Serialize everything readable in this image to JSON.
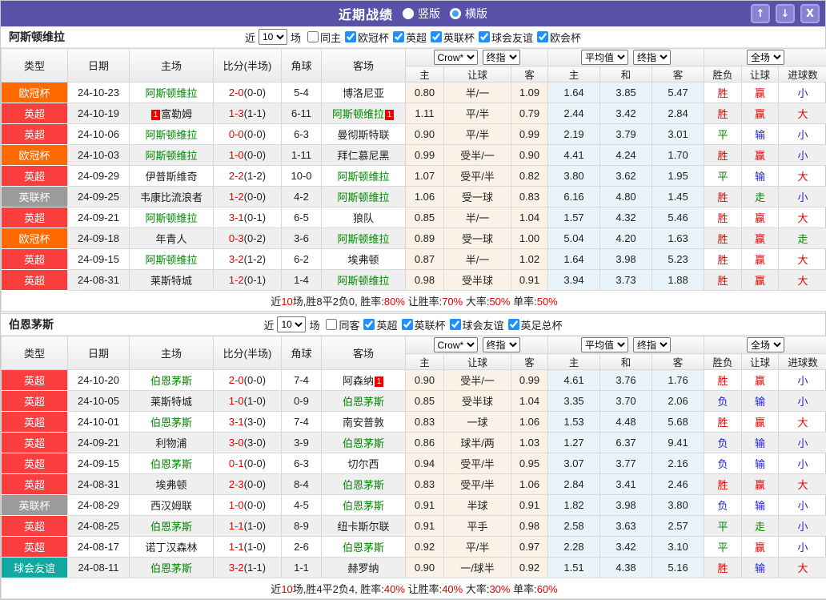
{
  "window": {
    "title": "近期战绩",
    "vertical_label": "竖版",
    "horizontal_label": "横版",
    "up_button": "↑",
    "down_button": "↓",
    "close_button": "X"
  },
  "table": {
    "cols": [
      "类型",
      "日期",
      "主场",
      "比分(半场)",
      "角球",
      "客场"
    ],
    "sub": [
      "主",
      "让球",
      "客",
      "主",
      "和",
      "客",
      "胜负",
      "让球",
      "进球数"
    ],
    "selects": {
      "crow": "Crow*",
      "final1": "终指",
      "avg": "平均值",
      "final2": "终指",
      "full": "全场"
    }
  },
  "league_colors": {
    "英超": "#fa3e3e",
    "欧冠杯": "#ff6a00",
    "英联杯": "#9b9b9b",
    "球会友谊": "#12a7a1"
  },
  "result_colors": {
    "r": "#e60000",
    "b": "#2323cc",
    "g": "#008800"
  },
  "sections": [
    {
      "team": "阿斯顿维拉",
      "filter": {
        "near": "近",
        "count": "10",
        "games": "场",
        "same": "同主",
        "same_checked": false,
        "leagues": [
          "欧冠杯",
          "英超",
          "英联杯",
          "球会友谊",
          "欧会杯"
        ]
      },
      "rows": [
        {
          "league": "欧冠杯",
          "date": "24-10-23",
          "home": "阿斯顿维拉",
          "home_self": true,
          "home_card": "",
          "score": "2-0",
          "half": "(0-0)",
          "corners": "5-4",
          "away": "博洛尼亚",
          "away_self": false,
          "away_card": "",
          "odds": [
            "0.80",
            "半/一",
            "1.09"
          ],
          "avg": [
            "1.64",
            "3.85",
            "5.47"
          ],
          "results": [
            [
              "胜",
              "r"
            ],
            [
              "赢",
              "r"
            ],
            [
              "小",
              "b"
            ]
          ]
        },
        {
          "league": "英超",
          "date": "24-10-19",
          "home": "富勒姆",
          "home_self": false,
          "home_card": "1",
          "score": "1-3",
          "half": "(1-1)",
          "corners": "6-11",
          "away": "阿斯顿维拉",
          "away_self": true,
          "away_card": "1",
          "odds": [
            "1.11",
            "平/半",
            "0.79"
          ],
          "avg": [
            "2.44",
            "3.42",
            "2.84"
          ],
          "results": [
            [
              "胜",
              "r"
            ],
            [
              "赢",
              "r"
            ],
            [
              "大",
              "r"
            ]
          ]
        },
        {
          "league": "英超",
          "date": "24-10-06",
          "home": "阿斯顿维拉",
          "home_self": true,
          "home_card": "",
          "score": "0-0",
          "half": "(0-0)",
          "corners": "6-3",
          "away": "曼彻斯特联",
          "away_self": false,
          "away_card": "",
          "odds": [
            "0.90",
            "平/半",
            "0.99"
          ],
          "avg": [
            "2.19",
            "3.79",
            "3.01"
          ],
          "results": [
            [
              "平",
              "g"
            ],
            [
              "输",
              "b"
            ],
            [
              "小",
              "b"
            ]
          ]
        },
        {
          "league": "欧冠杯",
          "date": "24-10-03",
          "home": "阿斯顿维拉",
          "home_self": true,
          "home_card": "",
          "score": "1-0",
          "half": "(0-0)",
          "corners": "1-11",
          "away": "拜仁慕尼黑",
          "away_self": false,
          "away_card": "",
          "odds": [
            "0.99",
            "受半/一",
            "0.90"
          ],
          "avg": [
            "4.41",
            "4.24",
            "1.70"
          ],
          "results": [
            [
              "胜",
              "r"
            ],
            [
              "赢",
              "r"
            ],
            [
              "小",
              "b"
            ]
          ]
        },
        {
          "league": "英超",
          "date": "24-09-29",
          "home": "伊普斯维奇",
          "home_self": false,
          "home_card": "",
          "score": "2-2",
          "half": "(1-2)",
          "corners": "10-0",
          "away": "阿斯顿维拉",
          "away_self": true,
          "away_card": "",
          "odds": [
            "1.07",
            "受平/半",
            "0.82"
          ],
          "avg": [
            "3.80",
            "3.62",
            "1.95"
          ],
          "results": [
            [
              "平",
              "g"
            ],
            [
              "输",
              "b"
            ],
            [
              "大",
              "r"
            ]
          ]
        },
        {
          "league": "英联杯",
          "date": "24-09-25",
          "home": "韦康比流浪者",
          "home_self": false,
          "home_card": "",
          "score": "1-2",
          "half": "(0-0)",
          "corners": "4-2",
          "away": "阿斯顿维拉",
          "away_self": true,
          "away_card": "",
          "odds": [
            "1.06",
            "受一球",
            "0.83"
          ],
          "avg": [
            "6.16",
            "4.80",
            "1.45"
          ],
          "results": [
            [
              "胜",
              "r"
            ],
            [
              "走",
              "g"
            ],
            [
              "小",
              "b"
            ]
          ]
        },
        {
          "league": "英超",
          "date": "24-09-21",
          "home": "阿斯顿维拉",
          "home_self": true,
          "home_card": "",
          "score": "3-1",
          "half": "(0-1)",
          "corners": "6-5",
          "away": "狼队",
          "away_self": false,
          "away_card": "",
          "odds": [
            "0.85",
            "半/一",
            "1.04"
          ],
          "avg": [
            "1.57",
            "4.32",
            "5.46"
          ],
          "results": [
            [
              "胜",
              "r"
            ],
            [
              "赢",
              "r"
            ],
            [
              "大",
              "r"
            ]
          ]
        },
        {
          "league": "欧冠杯",
          "date": "24-09-18",
          "home": "年青人",
          "home_self": false,
          "home_card": "",
          "score": "0-3",
          "half": "(0-2)",
          "corners": "3-6",
          "away": "阿斯顿维拉",
          "away_self": true,
          "away_card": "",
          "odds": [
            "0.89",
            "受一球",
            "1.00"
          ],
          "avg": [
            "5.04",
            "4.20",
            "1.63"
          ],
          "results": [
            [
              "胜",
              "r"
            ],
            [
              "赢",
              "r"
            ],
            [
              "走",
              "g"
            ]
          ]
        },
        {
          "league": "英超",
          "date": "24-09-15",
          "home": "阿斯顿维拉",
          "home_self": true,
          "home_card": "",
          "score": "3-2",
          "half": "(1-2)",
          "corners": "6-2",
          "away": "埃弗顿",
          "away_self": false,
          "away_card": "",
          "odds": [
            "0.87",
            "半/一",
            "1.02"
          ],
          "avg": [
            "1.64",
            "3.98",
            "5.23"
          ],
          "results": [
            [
              "胜",
              "r"
            ],
            [
              "赢",
              "r"
            ],
            [
              "大",
              "r"
            ]
          ]
        },
        {
          "league": "英超",
          "date": "24-08-31",
          "home": "莱斯特城",
          "home_self": false,
          "home_card": "",
          "score": "1-2",
          "half": "(0-1)",
          "corners": "1-4",
          "away": "阿斯顿维拉",
          "away_self": true,
          "away_card": "",
          "odds": [
            "0.98",
            "受半球",
            "0.91"
          ],
          "avg": [
            "3.94",
            "3.73",
            "1.88"
          ],
          "results": [
            [
              "胜",
              "r"
            ],
            [
              "赢",
              "r"
            ],
            [
              "大",
              "r"
            ]
          ]
        }
      ],
      "summary": [
        [
          "近",
          "k"
        ],
        [
          "10",
          "r"
        ],
        [
          "场,胜8平2负0, 胜率:",
          "k"
        ],
        [
          "80%",
          "r"
        ],
        [
          " 让胜率:",
          "k"
        ],
        [
          "70%",
          "r"
        ],
        [
          " 大率:",
          "k"
        ],
        [
          "50%",
          "r"
        ],
        [
          " 单率:",
          "k"
        ],
        [
          "50%",
          "r"
        ]
      ]
    },
    {
      "team": "伯恩茅斯",
      "filter": {
        "near": "近",
        "count": "10",
        "games": "场",
        "same": "同客",
        "same_checked": false,
        "leagues": [
          "英超",
          "英联杯",
          "球会友谊",
          "英足总杯"
        ]
      },
      "rows": [
        {
          "league": "英超",
          "date": "24-10-20",
          "home": "伯恩茅斯",
          "home_self": true,
          "home_card": "",
          "score": "2-0",
          "half": "(0-0)",
          "corners": "7-4",
          "away": "阿森纳",
          "away_self": false,
          "away_card": "1",
          "odds": [
            "0.90",
            "受半/一",
            "0.99"
          ],
          "avg": [
            "4.61",
            "3.76",
            "1.76"
          ],
          "results": [
            [
              "胜",
              "r"
            ],
            [
              "赢",
              "r"
            ],
            [
              "小",
              "b"
            ]
          ]
        },
        {
          "league": "英超",
          "date": "24-10-05",
          "home": "莱斯特城",
          "home_self": false,
          "home_card": "",
          "score": "1-0",
          "half": "(1-0)",
          "corners": "0-9",
          "away": "伯恩茅斯",
          "away_self": true,
          "away_card": "",
          "odds": [
            "0.85",
            "受半球",
            "1.04"
          ],
          "avg": [
            "3.35",
            "3.70",
            "2.06"
          ],
          "results": [
            [
              "负",
              "b"
            ],
            [
              "输",
              "b"
            ],
            [
              "小",
              "b"
            ]
          ]
        },
        {
          "league": "英超",
          "date": "24-10-01",
          "home": "伯恩茅斯",
          "home_self": true,
          "home_card": "",
          "score": "3-1",
          "half": "(3-0)",
          "corners": "7-4",
          "away": "南安普敦",
          "away_self": false,
          "away_card": "",
          "odds": [
            "0.83",
            "一球",
            "1.06"
          ],
          "avg": [
            "1.53",
            "4.48",
            "5.68"
          ],
          "results": [
            [
              "胜",
              "r"
            ],
            [
              "赢",
              "r"
            ],
            [
              "大",
              "r"
            ]
          ]
        },
        {
          "league": "英超",
          "date": "24-09-21",
          "home": "利物浦",
          "home_self": false,
          "home_card": "",
          "score": "3-0",
          "half": "(3-0)",
          "corners": "3-9",
          "away": "伯恩茅斯",
          "away_self": true,
          "away_card": "",
          "odds": [
            "0.86",
            "球半/两",
            "1.03"
          ],
          "avg": [
            "1.27",
            "6.37",
            "9.41"
          ],
          "results": [
            [
              "负",
              "b"
            ],
            [
              "输",
              "b"
            ],
            [
              "小",
              "b"
            ]
          ]
        },
        {
          "league": "英超",
          "date": "24-09-15",
          "home": "伯恩茅斯",
          "home_self": true,
          "home_card": "",
          "score": "0-1",
          "half": "(0-0)",
          "corners": "6-3",
          "away": "切尔西",
          "away_self": false,
          "away_card": "",
          "odds": [
            "0.94",
            "受平/半",
            "0.95"
          ],
          "avg": [
            "3.07",
            "3.77",
            "2.16"
          ],
          "results": [
            [
              "负",
              "b"
            ],
            [
              "输",
              "b"
            ],
            [
              "小",
              "b"
            ]
          ]
        },
        {
          "league": "英超",
          "date": "24-08-31",
          "home": "埃弗顿",
          "home_self": false,
          "home_card": "",
          "score": "2-3",
          "half": "(0-0)",
          "corners": "8-4",
          "away": "伯恩茅斯",
          "away_self": true,
          "away_card": "",
          "odds": [
            "0.83",
            "受平/半",
            "1.06"
          ],
          "avg": [
            "2.84",
            "3.41",
            "2.46"
          ],
          "results": [
            [
              "胜",
              "r"
            ],
            [
              "赢",
              "r"
            ],
            [
              "大",
              "r"
            ]
          ]
        },
        {
          "league": "英联杯",
          "date": "24-08-29",
          "home": "西汉姆联",
          "home_self": false,
          "home_card": "",
          "score": "1-0",
          "half": "(0-0)",
          "corners": "4-5",
          "away": "伯恩茅斯",
          "away_self": true,
          "away_card": "",
          "odds": [
            "0.91",
            "半球",
            "0.91"
          ],
          "avg": [
            "1.82",
            "3.98",
            "3.80"
          ],
          "results": [
            [
              "负",
              "b"
            ],
            [
              "输",
              "b"
            ],
            [
              "小",
              "b"
            ]
          ]
        },
        {
          "league": "英超",
          "date": "24-08-25",
          "home": "伯恩茅斯",
          "home_self": true,
          "home_card": "",
          "score": "1-1",
          "half": "(1-0)",
          "corners": "8-9",
          "away": "纽卡斯尔联",
          "away_self": false,
          "away_card": "",
          "odds": [
            "0.91",
            "平手",
            "0.98"
          ],
          "avg": [
            "2.58",
            "3.63",
            "2.57"
          ],
          "results": [
            [
              "平",
              "g"
            ],
            [
              "走",
              "g"
            ],
            [
              "小",
              "b"
            ]
          ]
        },
        {
          "league": "英超",
          "date": "24-08-17",
          "home": "诺丁汉森林",
          "home_self": false,
          "home_card": "",
          "score": "1-1",
          "half": "(1-0)",
          "corners": "2-6",
          "away": "伯恩茅斯",
          "away_self": true,
          "away_card": "",
          "odds": [
            "0.92",
            "平/半",
            "0.97"
          ],
          "avg": [
            "2.28",
            "3.42",
            "3.10"
          ],
          "results": [
            [
              "平",
              "g"
            ],
            [
              "赢",
              "r"
            ],
            [
              "小",
              "b"
            ]
          ]
        },
        {
          "league": "球会友谊",
          "date": "24-08-11",
          "home": "伯恩茅斯",
          "home_self": true,
          "home_card": "",
          "score": "3-2",
          "half": "(1-1)",
          "corners": "1-1",
          "away": "赫罗纳",
          "away_self": false,
          "away_card": "",
          "odds": [
            "0.90",
            "一/球半",
            "0.92"
          ],
          "avg": [
            "1.51",
            "4.38",
            "5.16"
          ],
          "results": [
            [
              "胜",
              "r"
            ],
            [
              "输",
              "b"
            ],
            [
              "大",
              "r"
            ]
          ]
        }
      ],
      "summary": [
        [
          "近",
          "k"
        ],
        [
          "10",
          "r"
        ],
        [
          "场,胜4平2负4, 胜率:",
          "k"
        ],
        [
          "40%",
          "r"
        ],
        [
          " 让胜率:",
          "k"
        ],
        [
          "40%",
          "r"
        ],
        [
          " 大率:",
          "k"
        ],
        [
          "30%",
          "r"
        ],
        [
          " 单率:",
          "k"
        ],
        [
          "60%",
          "r"
        ]
      ]
    }
  ]
}
